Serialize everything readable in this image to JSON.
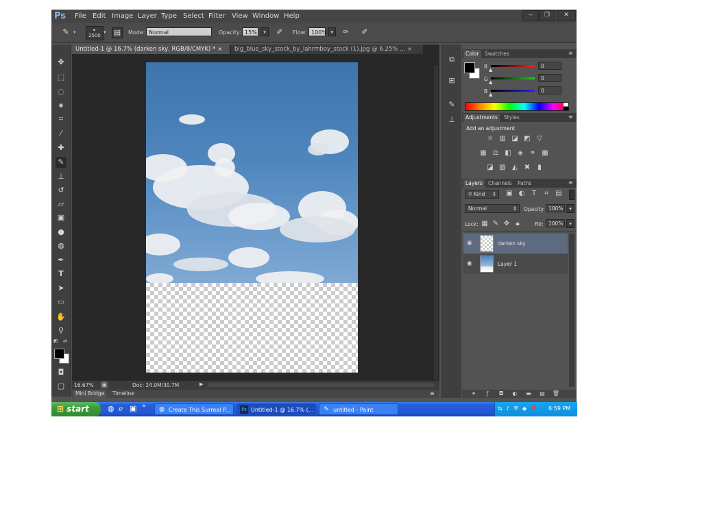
{
  "menubar": {
    "logo": "Ps",
    "items": [
      "File",
      "Edit",
      "Image",
      "Layer",
      "Type",
      "Select",
      "Filter",
      "View",
      "Window",
      "Help"
    ],
    "window_buttons": [
      "‒",
      "❐",
      "✕"
    ]
  },
  "options": {
    "brush_size": "2500",
    "mode_label": "Mode:",
    "mode_value": "Normal",
    "opacity_label": "Opacity:",
    "opacity_value": "15%",
    "flow_label": "Flow:",
    "flow_value": "100%"
  },
  "document": {
    "tabs": [
      {
        "label": "Untitled-1 @ 16.7% (darken sky, RGB/8/CMYK) *",
        "close": "×"
      },
      {
        "label": "big_blue_sky_stock_by_lahrmboy_stock (1).jpg @ 6.25% ...",
        "close": "×"
      }
    ],
    "zoom": "16.67%",
    "doc_info": "Doc: 24.0M/30.7M",
    "bottom_tabs": [
      "Mini Bridge",
      "Timeline"
    ]
  },
  "panels": {
    "color_tabs": [
      "Color",
      "Swatches"
    ],
    "channels": [
      {
        "label": "R",
        "value": "0",
        "color": "#ff2020"
      },
      {
        "label": "G",
        "value": "0",
        "color": "#22cc22"
      },
      {
        "label": "B",
        "value": "0",
        "color": "#2222ff"
      }
    ],
    "adjustment_tabs": [
      "Adjustments",
      "Styles"
    ],
    "adjustment_heading": "Add an adjustment",
    "layers_tabs": [
      "Layers",
      "Channels",
      "Paths"
    ],
    "kind_label": "Kind",
    "blend_mode": "Normal",
    "opacity_label": "Opacity:",
    "opacity_value": "100%",
    "lock_label": "Lock:",
    "fill_label": "Fill:",
    "fill_value": "100%",
    "layers": [
      {
        "name": "darken sky",
        "selected": true
      },
      {
        "name": "Layer 1",
        "selected": false
      }
    ]
  },
  "taskbar": {
    "start_label": "start",
    "tasks": [
      {
        "label": "Create This Surreal P...",
        "active": false
      },
      {
        "label": "Untitled-1 @ 16.7% (...",
        "active": true
      },
      {
        "label": "untitled - Paint",
        "active": false
      }
    ],
    "time": "6:59 PM"
  }
}
